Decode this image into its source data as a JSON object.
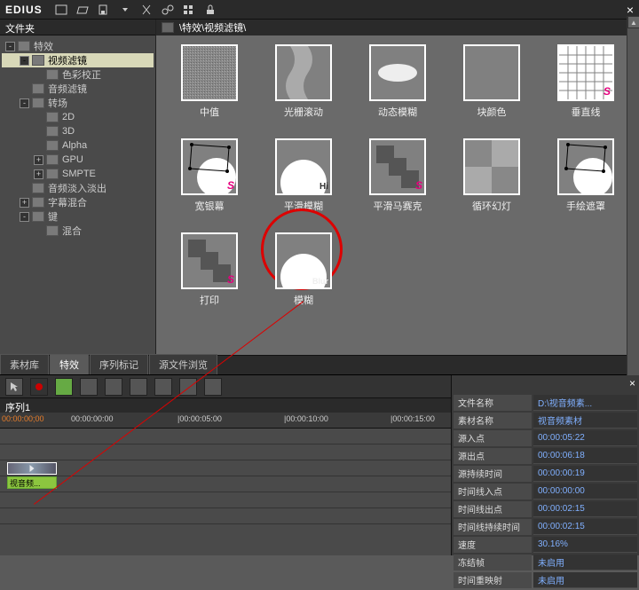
{
  "app": {
    "name": "EDIUS"
  },
  "sidebar": {
    "title": "文件夹",
    "tree": [
      {
        "label": "特效",
        "indent": 0,
        "exp": "-",
        "sel": false
      },
      {
        "label": "视频滤镜",
        "indent": 1,
        "exp": "-",
        "sel": true
      },
      {
        "label": "色彩校正",
        "indent": 2,
        "exp": "",
        "sel": false
      },
      {
        "label": "音频滤镜",
        "indent": 1,
        "exp": "",
        "sel": false
      },
      {
        "label": "转场",
        "indent": 1,
        "exp": "-",
        "sel": false
      },
      {
        "label": "2D",
        "indent": 2,
        "exp": "",
        "sel": false
      },
      {
        "label": "3D",
        "indent": 2,
        "exp": "",
        "sel": false
      },
      {
        "label": "Alpha",
        "indent": 2,
        "exp": "",
        "sel": false
      },
      {
        "label": "GPU",
        "indent": 2,
        "exp": "+",
        "sel": false
      },
      {
        "label": "SMPTE",
        "indent": 2,
        "exp": "+",
        "sel": false
      },
      {
        "label": "音频淡入淡出",
        "indent": 1,
        "exp": "",
        "sel": false
      },
      {
        "label": "字幕混合",
        "indent": 1,
        "exp": "+",
        "sel": false
      },
      {
        "label": "键",
        "indent": 1,
        "exp": "-",
        "sel": false
      },
      {
        "label": "混合",
        "indent": 2,
        "exp": "",
        "sel": false
      }
    ]
  },
  "breadcrumb": "\\特效\\视频滤镜\\",
  "thumbs": [
    {
      "label": "中值",
      "kind": "noise"
    },
    {
      "label": "光栅滚动",
      "kind": "wave"
    },
    {
      "label": "动态模糊",
      "kind": "motion"
    },
    {
      "label": "块颜色",
      "kind": "block"
    },
    {
      "label": "垂直线",
      "kind": "vgrid",
      "badge": "S"
    },
    {
      "label": "宽银幕",
      "kind": "mask",
      "badge": "S"
    },
    {
      "label": "平滑模糊",
      "kind": "glow",
      "badge": "Hi"
    },
    {
      "label": "平滑马赛克",
      "kind": "mosaic",
      "badge": "S"
    },
    {
      "label": "循环幻灯",
      "kind": "quad"
    },
    {
      "label": "手绘遮罩",
      "kind": "mask2"
    },
    {
      "label": "打印",
      "kind": "mosaic2",
      "badge": "S"
    },
    {
      "label": "模糊",
      "kind": "glow2",
      "badge": "Blur"
    },
    {
      "label": "",
      "kind": "partial1"
    },
    {
      "label": "",
      "kind": "partial2"
    },
    {
      "label": "",
      "kind": "partial3"
    },
    {
      "label": "",
      "kind": "partial4"
    }
  ],
  "tabs": [
    {
      "label": "素材库",
      "active": false
    },
    {
      "label": "特效",
      "active": true
    },
    {
      "label": "序列标记",
      "active": false
    },
    {
      "label": "源文件浏览",
      "active": false
    }
  ],
  "timeline": {
    "seq_label": "序列1",
    "timecodes": [
      "00:00:00:00",
      "|00:00:05:00",
      "|00:00:10:00",
      "|00:00:15:00"
    ],
    "current_tc": "00:00:00;00",
    "clip_audio_label": "视音频..."
  },
  "props": [
    {
      "k": "文件名称",
      "v": "D:\\视音频素..."
    },
    {
      "k": "素材名称",
      "v": "视音频素材"
    },
    {
      "k": "源入点",
      "v": "00:00:05:22"
    },
    {
      "k": "源出点",
      "v": "00:00:06:18"
    },
    {
      "k": "源持续时间",
      "v": "00:00:00:19"
    },
    {
      "k": "时间线入点",
      "v": "00:00:00:00"
    },
    {
      "k": "时间线出点",
      "v": "00:00:02:15"
    },
    {
      "k": "时间线持续时间",
      "v": "00:00:02:15"
    },
    {
      "k": "速度",
      "v": "30.16%"
    },
    {
      "k": "冻结帧",
      "v": "未启用"
    },
    {
      "k": "时间重映射",
      "v": "未启用"
    }
  ]
}
